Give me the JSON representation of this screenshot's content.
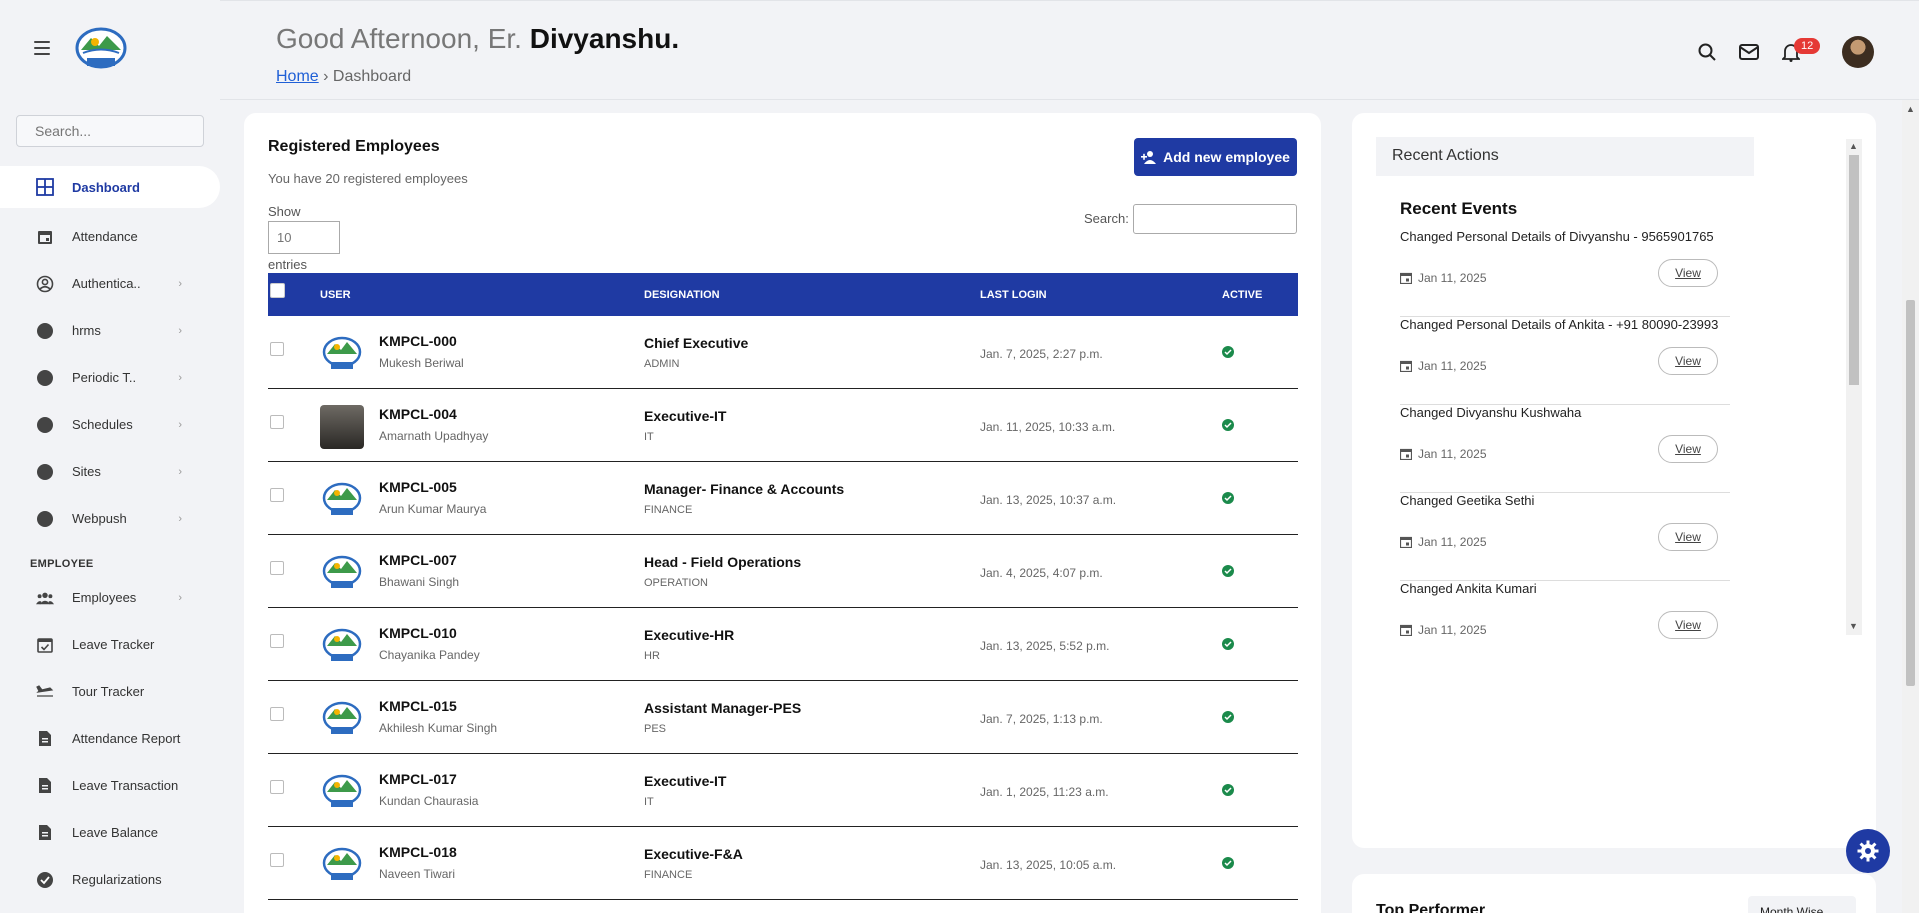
{
  "sidebar": {
    "search_placeholder": "Search...",
    "items": [
      {
        "label": "Dashboard",
        "icon": "grid-icon"
      },
      {
        "label": "Attendance",
        "icon": "calendar-icon"
      },
      {
        "label": "Authentica..",
        "icon": "user-circle-icon",
        "chevron": "›"
      },
      {
        "label": "hrms",
        "icon": "dot-icon",
        "chevron": "›"
      },
      {
        "label": "Periodic T..",
        "icon": "dot-icon",
        "chevron": "›"
      },
      {
        "label": "Schedules",
        "icon": "dot-icon",
        "chevron": "›"
      },
      {
        "label": "Sites",
        "icon": "dot-icon",
        "chevron": "›"
      },
      {
        "label": "Webpush",
        "icon": "dot-icon",
        "chevron": "›"
      }
    ],
    "section_employee": "EMPLOYEE",
    "employee_items": [
      {
        "label": "Employees",
        "icon": "users-icon",
        "chevron": "›"
      },
      {
        "label": "Leave Tracker",
        "icon": "calendar-check-icon"
      },
      {
        "label": "Tour Tracker",
        "icon": "plane-icon"
      },
      {
        "label": "Attendance Report",
        "icon": "document-icon"
      },
      {
        "label": "Leave Transaction",
        "icon": "document-icon"
      },
      {
        "label": "Leave Balance",
        "icon": "document-icon"
      },
      {
        "label": "Regularizations",
        "icon": "check-circle-icon"
      }
    ]
  },
  "header": {
    "greeting_prefix": "Good Afternoon, Er. ",
    "greeting_name": "Divyanshu.",
    "breadcrumb_home": "Home",
    "breadcrumb_sep": " › ",
    "breadcrumb_current": "Dashboard",
    "notification_count": "12"
  },
  "employees": {
    "title": "Registered Employees",
    "subtitle": "You have 20 registered employees",
    "add_button": "Add new employee",
    "show_label": "Show",
    "show_value_placeholder": "10",
    "entries_label": "entries",
    "search_label": "Search:",
    "columns": {
      "user": "USER",
      "designation": "DESIGNATION",
      "last_login": "LAST LOGIN",
      "active": "ACTIVE"
    },
    "rows": [
      {
        "code": "KMPCL-000",
        "name": "Mukesh Beriwal",
        "designation": "Chief Executive",
        "dept": "ADMIN",
        "last_login": "Jan. 7, 2025, 2:27 p.m."
      },
      {
        "code": "KMPCL-004",
        "name": "Amarnath Upadhyay",
        "designation": "Executive-IT",
        "dept": "IT",
        "last_login": "Jan. 11, 2025, 10:33 a.m."
      },
      {
        "code": "KMPCL-005",
        "name": "Arun Kumar Maurya",
        "designation": "Manager- Finance & Accounts",
        "dept": "FINANCE",
        "last_login": "Jan. 13, 2025, 10:37 a.m."
      },
      {
        "code": "KMPCL-007",
        "name": "Bhawani Singh",
        "designation": "Head - Field Operations",
        "dept": "OPERATION",
        "last_login": "Jan. 4, 2025, 4:07 p.m."
      },
      {
        "code": "KMPCL-010",
        "name": "Chayanika Pandey",
        "designation": "Executive-HR",
        "dept": "HR",
        "last_login": "Jan. 13, 2025, 5:52 p.m."
      },
      {
        "code": "KMPCL-015",
        "name": "Akhilesh Kumar Singh",
        "designation": "Assistant Manager-PES",
        "dept": "PES",
        "last_login": "Jan. 7, 2025, 1:13 p.m."
      },
      {
        "code": "KMPCL-017",
        "name": "Kundan Chaurasia",
        "designation": "Executive-IT",
        "dept": "IT",
        "last_login": "Jan. 1, 2025, 11:23 a.m."
      },
      {
        "code": "KMPCL-018",
        "name": "Naveen Tiwari",
        "designation": "Executive-F&A",
        "dept": "FINANCE",
        "last_login": "Jan. 13, 2025, 10:05 a.m."
      }
    ]
  },
  "recent": {
    "header": "Recent Actions",
    "title": "Recent Events",
    "view_label": "View",
    "events": [
      {
        "text": "Changed Personal Details of Divyanshu - 9565901765",
        "date": "Jan 11, 2025"
      },
      {
        "text": "Changed Personal Details of Ankita - +91 80090-23993",
        "date": "Jan 11, 2025"
      },
      {
        "text": "Changed Divyanshu Kushwaha",
        "date": "Jan 11, 2025"
      },
      {
        "text": "Changed Geetika Sethi",
        "date": "Jan 11, 2025"
      },
      {
        "text": "Changed Ankita Kumari",
        "date": "Jan 11, 2025"
      }
    ]
  },
  "top_performer": {
    "title": "Top Performer",
    "select": "Month Wise"
  },
  "colors": {
    "accent": "#1f3aa3",
    "active": "#1b8a4b",
    "badge": "#e53935"
  }
}
